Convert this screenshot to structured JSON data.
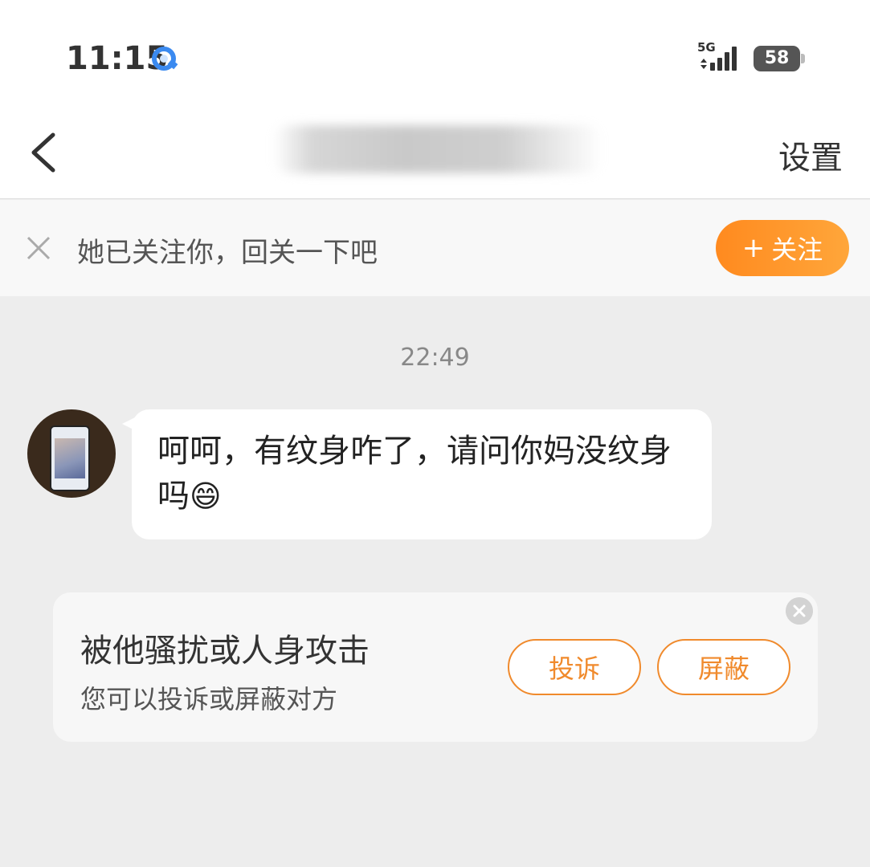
{
  "status_bar": {
    "time": "11:15",
    "network": "5G",
    "battery": "58"
  },
  "header": {
    "settings_label": "设置"
  },
  "follow_banner": {
    "text": "她已关注你，回关一下吧",
    "button_label": "关注",
    "button_plus": "+"
  },
  "chat": {
    "timestamp": "22:49",
    "messages": [
      {
        "text": "呵呵，有纹身咋了，请问你妈没纹身吗",
        "emoji": "😄"
      }
    ]
  },
  "report_card": {
    "title": "被他骚扰或人身攻击",
    "subtitle": "您可以投诉或屏蔽对方",
    "report_label": "投诉",
    "block_label": "屏蔽"
  },
  "colors": {
    "accent": "#ff8a1f",
    "background": "#ededed"
  }
}
